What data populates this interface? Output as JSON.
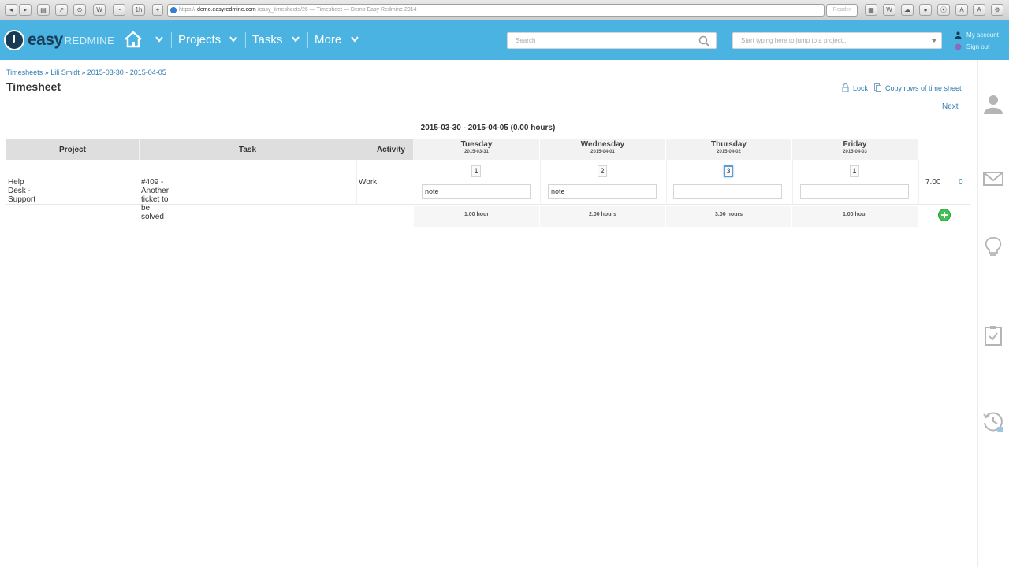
{
  "browser": {
    "url_prefix": "https://",
    "url_host": "demo.easyredmine.com",
    "url_rest": "/easy_timesheets/26 — Timesheet — Demo Easy Redmine 2014",
    "reader_label": "Reader"
  },
  "header": {
    "logo_main": "easy",
    "logo_sub": "REDMINE",
    "nav": {
      "projects": "Projects",
      "tasks": "Tasks",
      "more": "More"
    },
    "search_placeholder": "Search",
    "jump_placeholder": "Start typing here to jump to a project...",
    "my_account": "My account",
    "sign_out": "Sign out"
  },
  "page": {
    "breadcrumb": "Timesheets » Lili Smidt » 2015-03-30 - 2015-04-05",
    "title": "Timesheet",
    "lock": "Lock",
    "copy_rows": "Copy rows of time sheet",
    "next": "Next",
    "caption": "2015-03-30 - 2015-04-05 (0.00 hours)"
  },
  "table": {
    "headers": {
      "project": "Project",
      "task": "Task",
      "activity": "Activity"
    },
    "days": [
      {
        "name": "Tuesday",
        "date": "2015-03-31",
        "hours": "1",
        "note": "note",
        "total": "1.00 hour"
      },
      {
        "name": "Wednesday",
        "date": "2015-04-01",
        "hours": "2",
        "note": "note",
        "total": "2.00 hours"
      },
      {
        "name": "Thursday",
        "date": "2015-04-02",
        "hours": "3",
        "note": "",
        "total": "3.00 hours"
      },
      {
        "name": "Friday",
        "date": "2015-04-03",
        "hours": "1",
        "note": "",
        "total": "1.00 hour"
      }
    ],
    "row": {
      "project": "Help Desk - Support",
      "task": "#409 - Another ticket to be solved",
      "activity": "Work",
      "total": "7.00",
      "delete": "0"
    }
  },
  "icons": {
    "home": "home-icon",
    "search": "search-icon",
    "user": "user-icon",
    "mail": "mail-icon",
    "bulb": "lightbulb-icon",
    "clipboard": "clipboard-check-icon",
    "history": "history-icon",
    "add": "plus-circle-icon"
  },
  "colors": {
    "topbar": "#4ab3e2",
    "logo_dark": "#1a3b55",
    "link": "#2a7ab0",
    "add": "#3ec251"
  }
}
